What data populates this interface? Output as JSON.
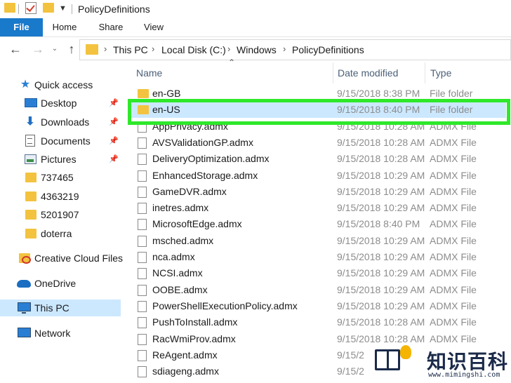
{
  "window": {
    "title": "PolicyDefinitions"
  },
  "ribbon": {
    "tabs": [
      {
        "label": "File"
      },
      {
        "label": "Home"
      },
      {
        "label": "Share"
      },
      {
        "label": "View"
      }
    ]
  },
  "address": {
    "crumbs": [
      "This PC",
      "Local Disk (C:)",
      "Windows",
      "PolicyDefinitions"
    ]
  },
  "sidebar": {
    "items": [
      {
        "label": "Quick access",
        "icon": "star-icon"
      },
      {
        "label": "Desktop",
        "icon": "desktop-icon",
        "pinned": true
      },
      {
        "label": "Downloads",
        "icon": "download-icon",
        "pinned": true
      },
      {
        "label": "Documents",
        "icon": "documents-icon",
        "pinned": true
      },
      {
        "label": "Pictures",
        "icon": "pictures-icon",
        "pinned": true
      },
      {
        "label": "737465",
        "icon": "folder-icon"
      },
      {
        "label": "4363219",
        "icon": "folder-icon"
      },
      {
        "label": "5201907",
        "icon": "folder-icon"
      },
      {
        "label": "doterra",
        "icon": "folder-icon"
      },
      {
        "label": "Creative Cloud Files",
        "icon": "creative-cloud-icon"
      },
      {
        "label": "OneDrive",
        "icon": "onedrive-icon"
      },
      {
        "label": "This PC",
        "icon": "pc-icon",
        "selected": true
      },
      {
        "label": "Network",
        "icon": "network-icon"
      }
    ]
  },
  "columns": {
    "name": "Name",
    "date": "Date modified",
    "type": "Type"
  },
  "files": [
    {
      "name": "en-GB",
      "date": "9/15/2018 8:38 PM",
      "type": "File folder",
      "kind": "folder"
    },
    {
      "name": "en-US",
      "date": "9/15/2018 8:40 PM",
      "type": "File folder",
      "kind": "folder",
      "selected": true
    },
    {
      "name": "AppPrivacy.admx",
      "date": "9/15/2018 10:28 AM",
      "type": "ADMX File",
      "kind": "file"
    },
    {
      "name": "AVSValidationGP.admx",
      "date": "9/15/2018 10:28 AM",
      "type": "ADMX File",
      "kind": "file"
    },
    {
      "name": "DeliveryOptimization.admx",
      "date": "9/15/2018 10:28 AM",
      "type": "ADMX File",
      "kind": "file"
    },
    {
      "name": "EnhancedStorage.admx",
      "date": "9/15/2018 10:29 AM",
      "type": "ADMX File",
      "kind": "file"
    },
    {
      "name": "GameDVR.admx",
      "date": "9/15/2018 10:29 AM",
      "type": "ADMX File",
      "kind": "file"
    },
    {
      "name": "inetres.admx",
      "date": "9/15/2018 10:29 AM",
      "type": "ADMX File",
      "kind": "file"
    },
    {
      "name": "MicrosoftEdge.admx",
      "date": "9/15/2018 8:40 PM",
      "type": "ADMX File",
      "kind": "file"
    },
    {
      "name": "msched.admx",
      "date": "9/15/2018 10:29 AM",
      "type": "ADMX File",
      "kind": "file"
    },
    {
      "name": "nca.admx",
      "date": "9/15/2018 10:29 AM",
      "type": "ADMX File",
      "kind": "file"
    },
    {
      "name": "NCSI.admx",
      "date": "9/15/2018 10:29 AM",
      "type": "ADMX File",
      "kind": "file"
    },
    {
      "name": "OOBE.admx",
      "date": "9/15/2018 10:29 AM",
      "type": "ADMX File",
      "kind": "file"
    },
    {
      "name": "PowerShellExecutionPolicy.admx",
      "date": "9/15/2018 10:29 AM",
      "type": "ADMX File",
      "kind": "file"
    },
    {
      "name": "PushToInstall.admx",
      "date": "9/15/2018 10:28 AM",
      "type": "ADMX File",
      "kind": "file"
    },
    {
      "name": "RacWmiProv.admx",
      "date": "9/15/2018 10:28 AM",
      "type": "ADMX File",
      "kind": "file"
    },
    {
      "name": "ReAgent.admx",
      "date": "9/15/2",
      "type": "",
      "kind": "file"
    },
    {
      "name": "sdiageng.admx",
      "date": "9/15/2",
      "type": "",
      "kind": "file"
    }
  ],
  "colors": {
    "accent": "#1979ca",
    "selection": "#cce8ff",
    "highlight": "#2ee82a",
    "folder": "#f3c33f"
  },
  "watermark": {
    "title": "知识百科",
    "url": "www.mimingshi.com"
  }
}
